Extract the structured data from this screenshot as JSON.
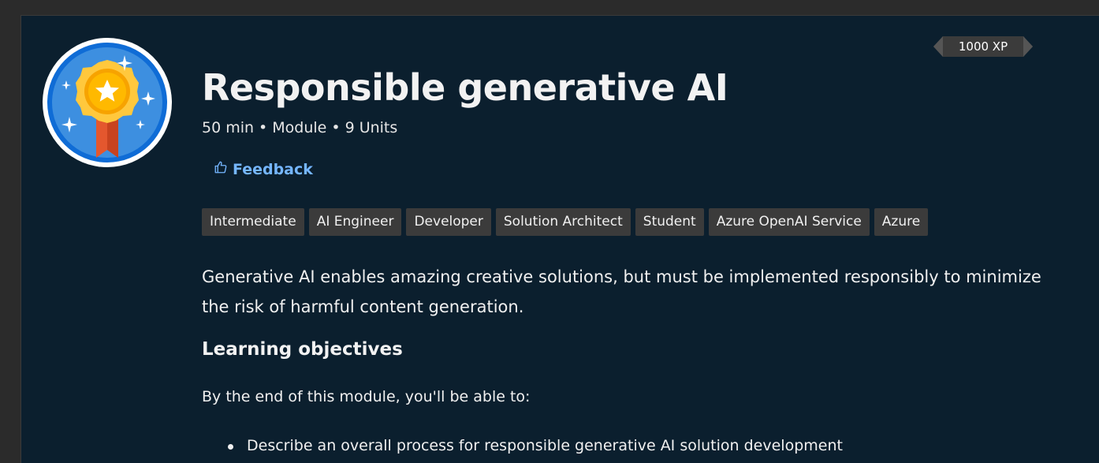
{
  "module": {
    "title": "Responsible generative AI",
    "duration": "50 min",
    "type": "Module",
    "units": "9 Units",
    "xp": "1000 XP",
    "badge_icon": "award-medal-icon"
  },
  "feedback": {
    "label": "Feedback",
    "icon": "thumbs-up-icon"
  },
  "tags": [
    "Intermediate",
    "AI Engineer",
    "Developer",
    "Solution Architect",
    "Student",
    "Azure OpenAI Service",
    "Azure"
  ],
  "description": "Generative AI enables amazing creative solutions, but must be implemented responsibly to minimize the risk of harmful content generation.",
  "objectives": {
    "heading": "Learning objectives",
    "intro": "By the end of this module, you'll be able to:",
    "items": [
      "Describe an overall process for responsible generative AI solution development"
    ]
  },
  "colors": {
    "background": "#0b1f2e",
    "link": "#75b6ff",
    "tag_bg": "#3b3b3b"
  }
}
